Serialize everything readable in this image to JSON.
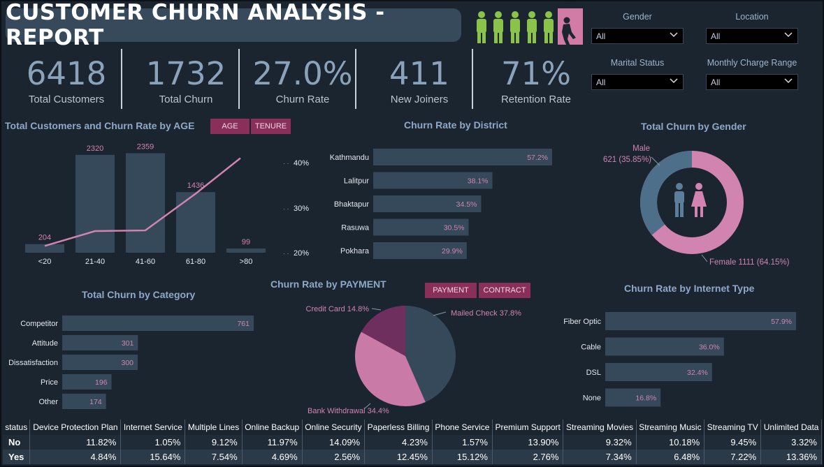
{
  "title": "CUSTOMER CHURN ANALYSIS - REPORT",
  "churn_badge": "CHURN",
  "kpis": [
    {
      "value": "6418",
      "label": "Total Customers"
    },
    {
      "value": "1732",
      "label": "Total Churn"
    },
    {
      "value": "27.0%",
      "label": "Churn Rate"
    },
    {
      "value": "411",
      "label": "New Joiners"
    },
    {
      "value": "71%",
      "label": "Retention Rate"
    }
  ],
  "slicers": [
    {
      "label": "Gender",
      "value": "All"
    },
    {
      "label": "Location",
      "value": "All"
    },
    {
      "label": "Marital Status",
      "value": "All"
    },
    {
      "label": "Monthly Charge Range",
      "value": "All"
    }
  ],
  "colors": {
    "bar": "#36495a",
    "pink": "#d184b0",
    "accent": "#8a2e5a",
    "title": "#8ea9c8"
  },
  "age_chart": {
    "title": "Total Customers and Churn Rate by AGE",
    "toggle": [
      "AGE",
      "TENURE"
    ],
    "chart_data": {
      "type": "bar",
      "categories": [
        "<20",
        "21-40",
        "41-60",
        "61-80",
        ">80"
      ],
      "values": [
        204,
        2320,
        2359,
        1436,
        99
      ],
      "value_labels": [
        "204",
        "2320",
        "2359",
        "1436",
        "99"
      ],
      "line": [
        16,
        20.4,
        20.6,
        31.5,
        42
      ],
      "ylim": [
        0,
        2600
      ],
      "line_ylim": [
        14,
        45
      ],
      "axis_ticks": [
        "40%",
        "30%",
        "20%"
      ]
    }
  },
  "district_chart": {
    "title": "Churn Rate by District",
    "chart_data": {
      "type": "bar",
      "categories": [
        "Kathmandu",
        "Lalitpur",
        "Bhaktapur",
        "Rasuwa",
        "Pokhara"
      ],
      "values": [
        57.2,
        38.1,
        34.5,
        30.5,
        29.9
      ],
      "value_labels": [
        "57.2%",
        "38.1%",
        "34.5%",
        "30.5%",
        "29.9%"
      ]
    }
  },
  "gender_chart": {
    "title": "Total Churn by Gender",
    "chart_data": {
      "type": "pie",
      "categories": [
        "Male",
        "Female"
      ],
      "values": [
        621,
        1111
      ],
      "labels": [
        "Male",
        "621 (35.85%)",
        "Female 1111 (64.15%)"
      ]
    }
  },
  "category_chart": {
    "title": "Total Churn by Category",
    "chart_data": {
      "type": "bar",
      "categories": [
        "Competitor",
        "Attitude",
        "Dissatisfaction",
        "Price",
        "Other"
      ],
      "values": [
        761,
        301,
        300,
        196,
        174
      ],
      "value_labels": [
        "761",
        "301",
        "300",
        "196",
        "174"
      ]
    }
  },
  "payment_chart": {
    "title": "Churn Rate by PAYMENT",
    "toggle": [
      "PAYMENT",
      "CONTRACT"
    ],
    "chart_data": {
      "type": "pie",
      "categories": [
        "Mailed Check",
        "Bank Withdrawal",
        "Credit Card"
      ],
      "values": [
        37.8,
        34.4,
        14.8
      ],
      "labels": [
        "Mailed Check 37.8%",
        "Bank Withdrawal 34.4%",
        "Credit Card 14.8%"
      ],
      "colors": [
        "#36495a",
        "#c97aa6",
        "#6e2f5e"
      ]
    }
  },
  "internet_chart": {
    "title": "Churn Rate by Internet Type",
    "chart_data": {
      "type": "bar",
      "categories": [
        "Fiber Optic",
        "Cable",
        "DSL",
        "None"
      ],
      "values": [
        57.9,
        36.0,
        32.4,
        16.8
      ],
      "value_labels": [
        "57.9%",
        "36.0%",
        "32.4%",
        "16.8%"
      ]
    }
  },
  "matrix": {
    "headers": [
      "status",
      "Device Protection Plan",
      "Internet Service",
      "Multiple Lines",
      "Online Backup",
      "Online Security",
      "Paperless Billing",
      "Phone Service",
      "Premium Support",
      "Streaming Movies",
      "Streaming Music",
      "Streaming TV",
      "Unlimited Data"
    ],
    "rows": [
      [
        "No",
        "11.82%",
        "1.05%",
        "9.12%",
        "11.97%",
        "14.09%",
        "4.23%",
        "1.57%",
        "13.90%",
        "9.32%",
        "10.18%",
        "9.45%",
        "3.32%"
      ],
      [
        "Yes",
        "4.84%",
        "15.64%",
        "7.54%",
        "4.69%",
        "2.56%",
        "12.45%",
        "15.12%",
        "2.76%",
        "7.34%",
        "6.48%",
        "7.22%",
        "13.36%"
      ]
    ]
  }
}
